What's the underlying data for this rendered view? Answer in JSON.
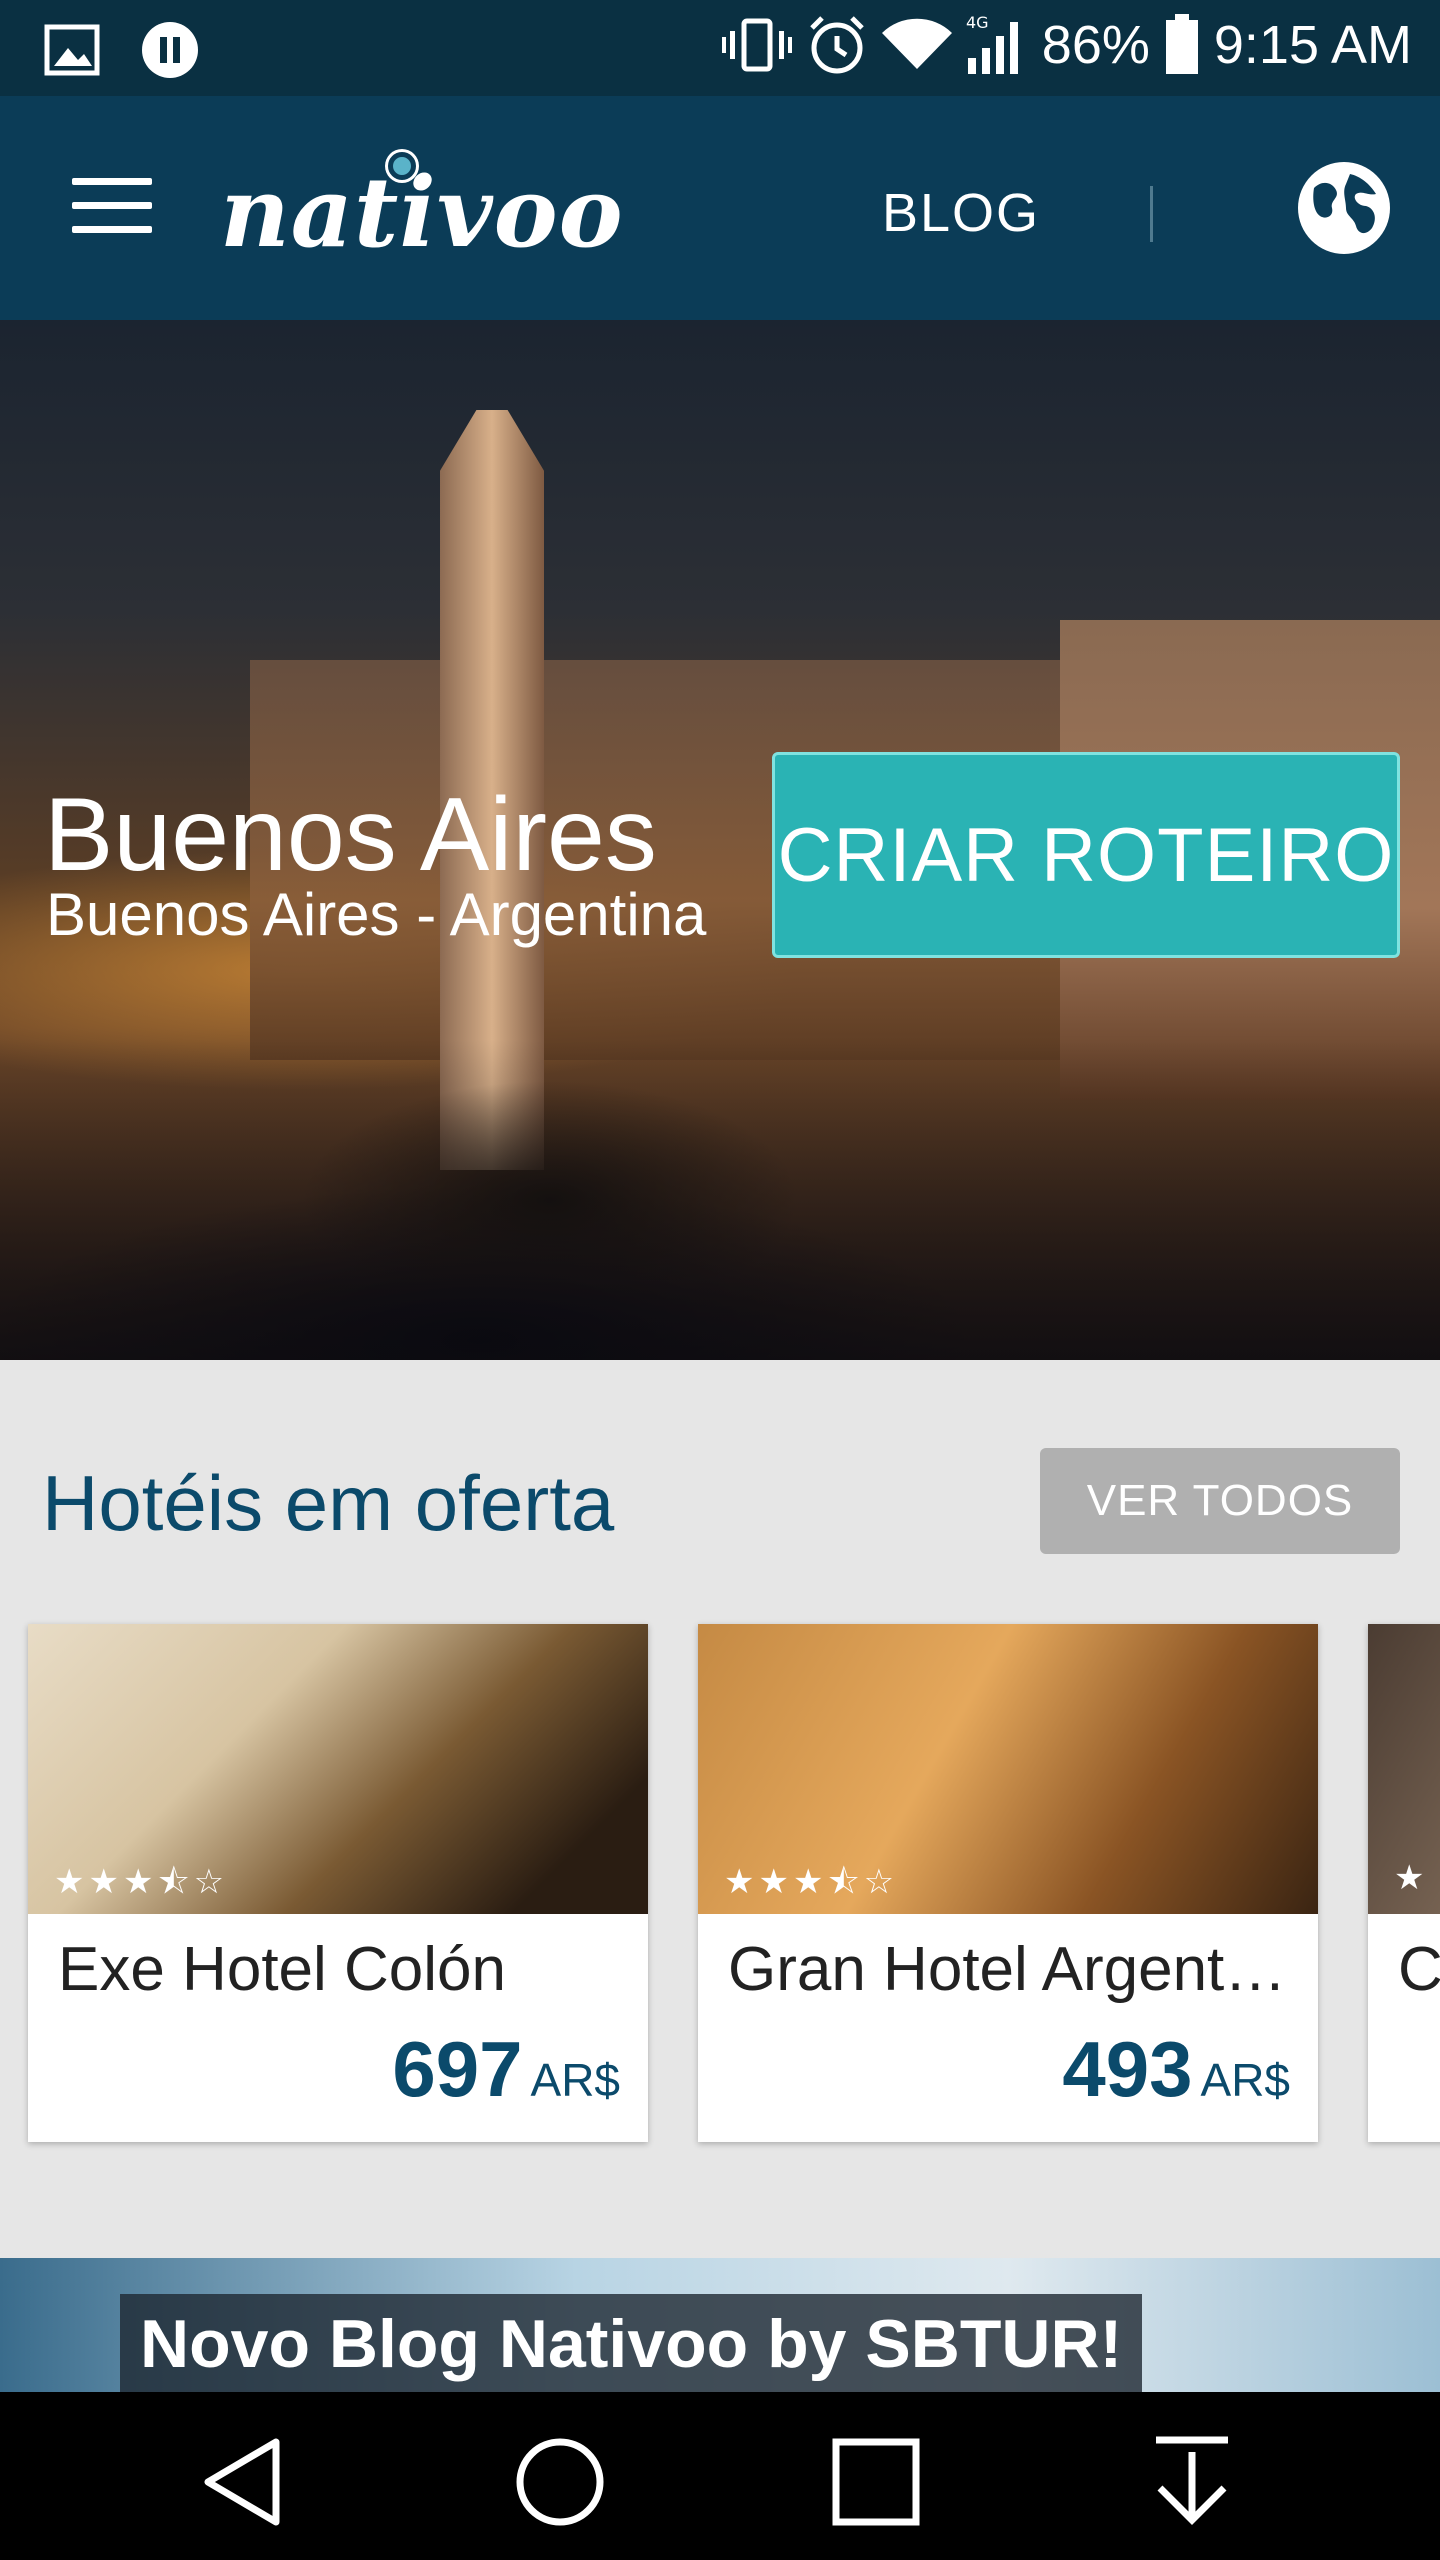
{
  "status_bar": {
    "battery": "86%",
    "time": "9:15 AM",
    "network": "4G"
  },
  "header": {
    "logo": "nativoo",
    "blog_link": "BLOG",
    "icons": [
      "menu-icon",
      "globe-icon"
    ]
  },
  "hero": {
    "title": "Buenos Aires",
    "subtitle": "Buenos Aires - Argentina",
    "cta_label": "CRIAR ROTEIRO"
  },
  "hotels": {
    "section_title": "Hotéis em oferta",
    "see_all_label": "VER TODOS",
    "items": [
      {
        "name": "Exe Hotel Colón",
        "price": "697",
        "currency": "AR$",
        "stars": "★★★⯪☆",
        "rating": 3.5
      },
      {
        "name": "Gran Hotel Argent…",
        "price": "493",
        "currency": "AR$",
        "stars": "★★★⯪☆",
        "rating": 3.5
      },
      {
        "name": "C",
        "price": "",
        "currency": "",
        "stars": "★",
        "rating": 0
      }
    ]
  },
  "blog_banner": {
    "text": "Novo Blog Nativoo by SBTUR!"
  },
  "colors": {
    "app_bar": "#0b3c57",
    "cta": "#2ab3b4",
    "accent_text": "#0b4a6b",
    "see_all_bg": "#b0b0b0"
  }
}
